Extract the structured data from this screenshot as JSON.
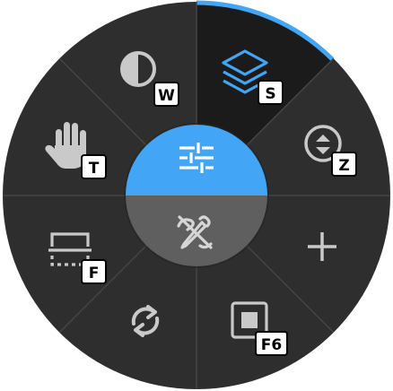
{
  "colors": {
    "wheel_bg": "#2e2e2e",
    "segment_active": "#1b1b1b",
    "divider": "#454545",
    "icon": "#c9c9c9",
    "accent": "#42a5f5",
    "center_bottom": "#5f5f5f",
    "center_icon_bottom": "#d6d6d6",
    "badge_bg": "#ffffff",
    "badge_text": "#000000",
    "badge_border": "#000000"
  },
  "radial_menu": {
    "items": [
      {
        "id": "layers",
        "icon": "layers-icon",
        "shortcut": "S",
        "active": true
      },
      {
        "id": "spinner",
        "icon": "spinner-up-down-icon",
        "shortcut": "Z",
        "active": false
      },
      {
        "id": "add",
        "icon": "plus-icon",
        "shortcut": "",
        "active": false
      },
      {
        "id": "stop",
        "icon": "stop-square-icon",
        "shortcut": "F6",
        "active": false
      },
      {
        "id": "sync",
        "icon": "sync-icon",
        "shortcut": "",
        "active": false
      },
      {
        "id": "frame",
        "icon": "dashed-frame-icon",
        "shortcut": "F",
        "active": false
      },
      {
        "id": "pan",
        "icon": "hand-icon",
        "shortcut": "T",
        "active": false
      },
      {
        "id": "contrast",
        "icon": "contrast-icon",
        "shortcut": "W",
        "active": false
      }
    ],
    "center": {
      "top_icon": "sliders-icon",
      "bottom_icon": "edit-off-icon"
    }
  }
}
